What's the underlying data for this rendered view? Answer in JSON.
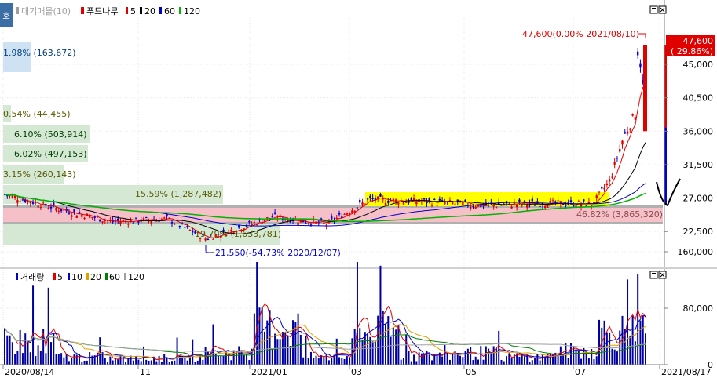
{
  "price_legend": {
    "series_name": "대기매물",
    "series_count": "(10)",
    "stock_name": "푸드나무",
    "ma": [
      "5",
      "20",
      "60",
      "120"
    ]
  },
  "volume_legend": {
    "title": "거래량",
    "ma": [
      "5",
      "10",
      "20",
      "60",
      "120"
    ]
  },
  "colors": {
    "ma5": "#e00000",
    "ma20": "#000000",
    "ma60": "#0000c8",
    "ma120": "#00b400",
    "up": "#e00000",
    "down": "#0000d0",
    "profile": "#d4e8d4",
    "highlight": "#ffff00",
    "band": "#f4b8c0",
    "last_price_bg": "#e00000"
  },
  "price_axis": [
    "45,000",
    "40,500",
    "36,000",
    "31,500",
    "27,000",
    "22,500"
  ],
  "volume_axis": [
    "160,000",
    "80,000",
    "0"
  ],
  "date_axis": [
    "2020/08/14",
    "11",
    "2021/01",
    "03",
    "05",
    "07",
    "2021/08/17"
  ],
  "volume_profile": [
    {
      "pct": "1.98%",
      "vol": "(163,672)"
    },
    {
      "pct": "0.54%",
      "vol": "(44,455)"
    },
    {
      "pct": "6.10%",
      "vol": "(503,914)"
    },
    {
      "pct": "6.02%",
      "vol": "(497,153)"
    },
    {
      "pct": "3.15%",
      "vol": "(260,143)"
    },
    {
      "pct": "15.59%",
      "vol": "(1,287,482)"
    },
    {
      "pct": "46.82%",
      "vol": "(3,865,320)"
    },
    {
      "pct": "19.79%",
      "vol": "(1,633,781)"
    }
  ],
  "annotations": {
    "high": "47,600(0.00% 2021/08/10)",
    "low": "21,550(-54.73% 2020/12/07)",
    "last_price": "47,600",
    "last_change": "( 29.86%)"
  },
  "chart_data": [
    {
      "type": "line",
      "title": "푸드나무",
      "x": [
        "2020/08/14",
        "2020/09/15",
        "2020/10/15",
        "2020/11/16",
        "2020/12/07",
        "2021/01/15",
        "2021/02/15",
        "2021/03/10",
        "2021/04/15",
        "2021/05/14",
        "2021/06/15",
        "2021/07/15",
        "2021/07/26",
        "2021/08/02",
        "2021/08/09",
        "2021/08/10",
        "2021/08/17"
      ],
      "series": [
        {
          "name": "close",
          "values": [
            27500,
            25500,
            23800,
            24200,
            21550,
            24500,
            23500,
            26800,
            26500,
            26000,
            26300,
            26200,
            29500,
            35000,
            38500,
            47600,
            36500
          ]
        }
      ],
      "ylim": [
        20000,
        48500
      ],
      "high": {
        "value": 47600,
        "date": "2021/08/10"
      },
      "low": {
        "value": 21550,
        "date": "2020/12/07"
      }
    },
    {
      "type": "bar",
      "title": "거래량",
      "categories": [
        "2020/08",
        "2020/09",
        "2020/10",
        "2020/11",
        "2020/12",
        "2021/01",
        "2021/02",
        "2021/03",
        "2021/04",
        "2021/05",
        "2021/06",
        "2021/07",
        "2021/08"
      ],
      "values": [
        120000,
        40000,
        30000,
        35000,
        60000,
        190000,
        40000,
        170000,
        45000,
        60000,
        40000,
        70000,
        170000
      ],
      "ylim": [
        0,
        200000
      ]
    }
  ]
}
